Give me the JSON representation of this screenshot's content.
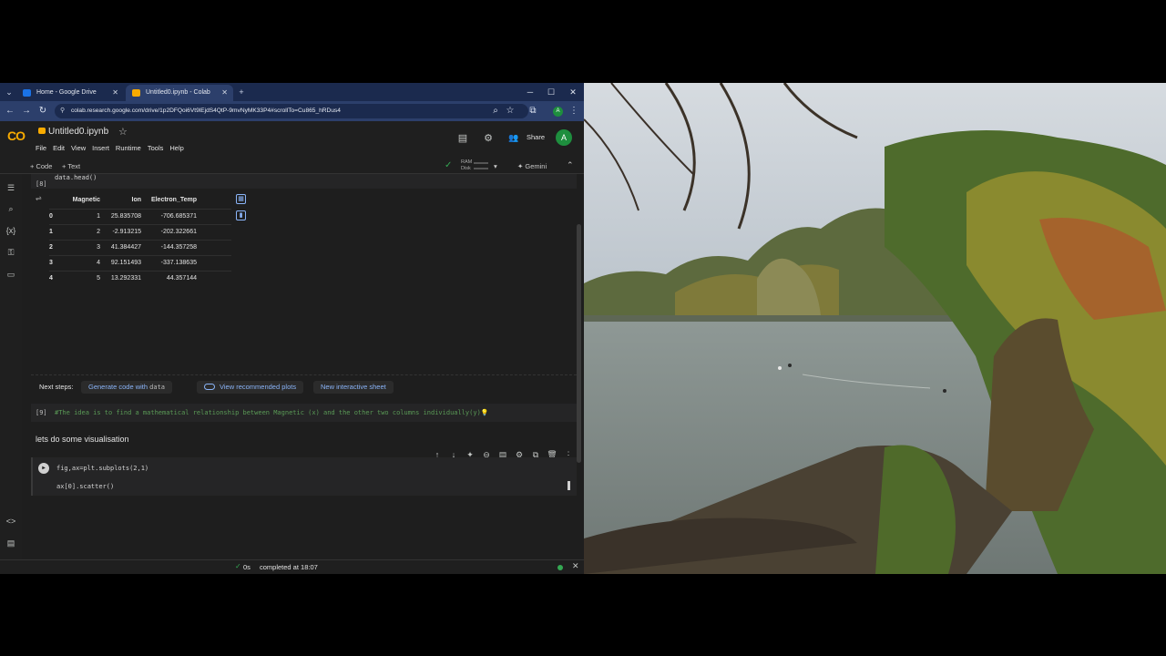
{
  "browser": {
    "tabs": [
      {
        "label": "Home - Google Drive",
        "active": false
      },
      {
        "label": "Untitled0.ipynb - Colab",
        "active": true
      }
    ],
    "url": "colab.research.google.com/drive/1p2DFQoi6Vt9lEjdS4QtP-9mvNyMK33P4#scrollTo=Cu865_hRDus4",
    "profile_initial": "A"
  },
  "colab": {
    "logo": "CO",
    "notebook_title": "Untitled0.ipynb",
    "menu": [
      "File",
      "Edit",
      "View",
      "Insert",
      "Runtime",
      "Tools",
      "Help"
    ],
    "share_label": "Share",
    "user_initial": "A",
    "toolbar": {
      "add_code": "+ Code",
      "add_text": "+ Text",
      "ram_label": "RAM",
      "disk_label": "Disk",
      "gemini_label": "Gemini"
    }
  },
  "cells": {
    "c8": {
      "count": "[8]",
      "source": "data.head()"
    },
    "dataframe": {
      "columns": [
        "Magnetic",
        "Ion",
        "Electron_Temp"
      ],
      "rows": [
        [
          "0",
          "1",
          "25.835708",
          "-706.685371"
        ],
        [
          "1",
          "2",
          "-2.913215",
          "-202.322661"
        ],
        [
          "2",
          "3",
          "41.384427",
          "-144.357258"
        ],
        [
          "3",
          "4",
          "92.151493",
          "-337.138635"
        ],
        [
          "4",
          "5",
          "13.292331",
          "44.357144"
        ]
      ]
    },
    "next_steps": {
      "label": "Next steps:",
      "generate": "Generate code with",
      "generate_var": "data",
      "recommended": "View recommended plots",
      "sheet": "New interactive sheet"
    },
    "c9": {
      "count": "[9]",
      "source": "#The idea is to find a mathematical relationship between Magnetic (x)  and the other two columns individually(y)"
    },
    "text_cell": "lets do some visualisation",
    "c10": {
      "line1": "fig,ax=plt.subplots(2,1)",
      "line2": "ax[0].scatter()"
    }
  },
  "status": {
    "duration": "0s",
    "message": "completed at 18:07"
  },
  "colors": {
    "accent": "#8ab4f8",
    "ok": "#34a853",
    "logo": "#f9ab00"
  }
}
